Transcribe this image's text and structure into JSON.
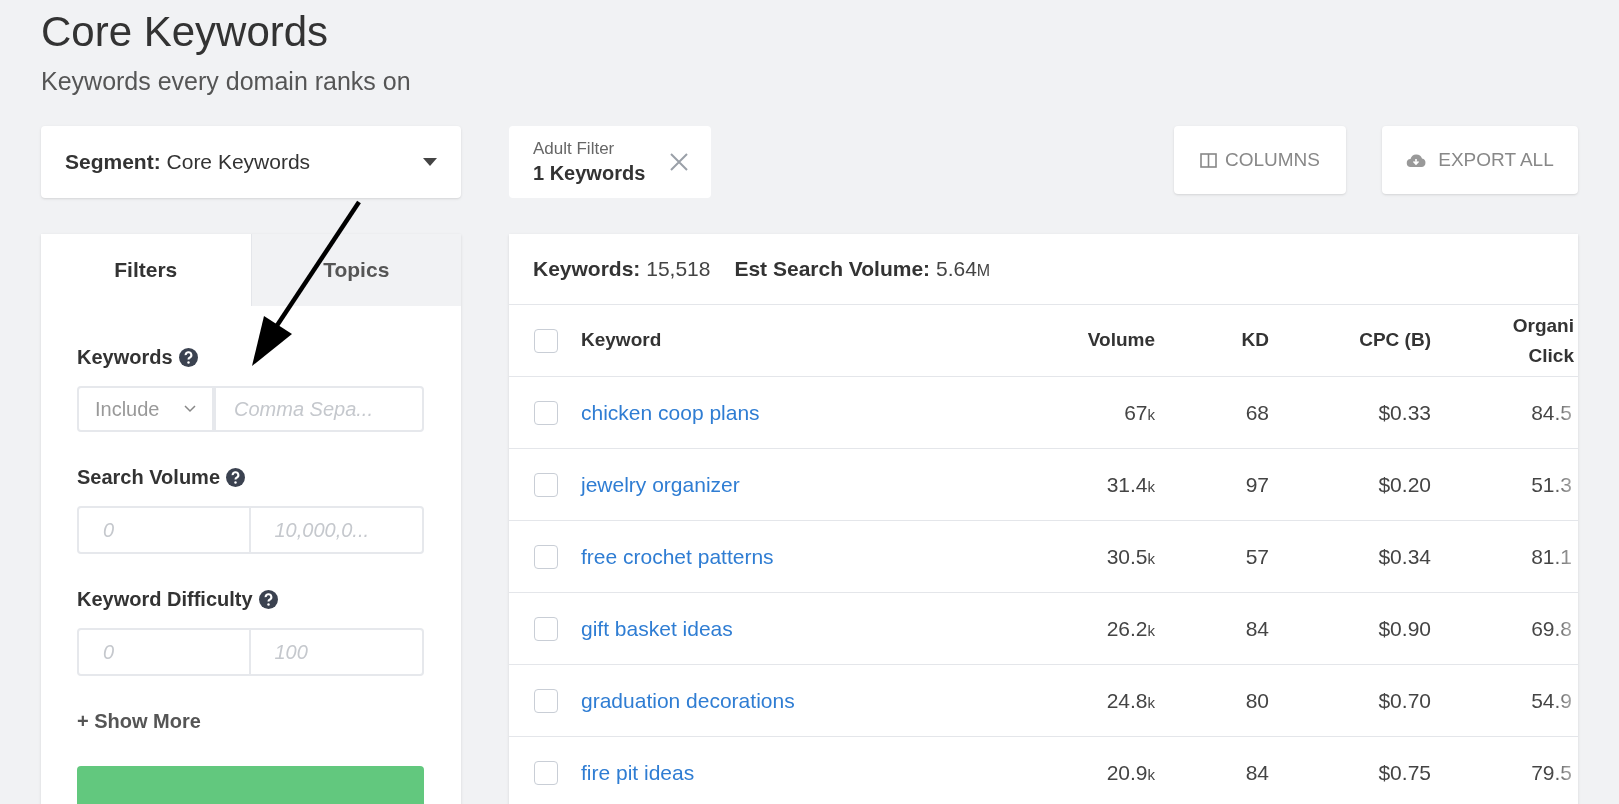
{
  "page": {
    "title": "Core Keywords",
    "subtitle": "Keywords every domain ranks on"
  },
  "segment": {
    "label": "Segment:",
    "value": "Core Keywords"
  },
  "active_filter": {
    "label": "Adult Filter",
    "value": "1 Keywords"
  },
  "toolbar": [
    "COLUMNS",
    "EXPORT ALL"
  ],
  "side_tabs": [
    {
      "label": "Filters",
      "selected": true
    },
    {
      "label": "Topics",
      "selected": false
    }
  ],
  "filters": [
    {
      "kind": "text",
      "label": "Keywords",
      "mode": "Include",
      "placeholder": "Comma Sepa..."
    },
    {
      "kind": "range",
      "label": "Search Volume",
      "min_placeholder": "0",
      "max_placeholder": "10,000,0..."
    },
    {
      "kind": "range",
      "label": "Keyword Difficulty",
      "min_placeholder": "0",
      "max_placeholder": "100"
    }
  ],
  "show_more": "+ Show More",
  "summary": [
    {
      "label": "Keywords:",
      "value": "15,518"
    },
    {
      "label": "Est Search Volume:",
      "value": "5.64",
      "unit": "M"
    }
  ],
  "table": {
    "all_checked": false,
    "columns": [
      {
        "label": "Keyword"
      },
      {
        "label": "Volume"
      },
      {
        "label": "KD"
      },
      {
        "label": "CPC (B)"
      },
      {
        "label": "Organi",
        "label_2": "Click"
      }
    ],
    "rows": [
      {
        "checked": false,
        "keyword": "chicken coop plans",
        "volume": "67",
        "unit": "k",
        "kd": "68",
        "cpc": "$0.33",
        "organic": "84.5"
      },
      {
        "checked": false,
        "keyword": "jewelry organizer",
        "volume": "31.4",
        "unit": "k",
        "kd": "97",
        "cpc": "$0.20",
        "organic": "51.3"
      },
      {
        "checked": false,
        "keyword": "free crochet patterns",
        "volume": "30.5",
        "unit": "k",
        "kd": "57",
        "cpc": "$0.34",
        "organic": "81.1"
      },
      {
        "checked": false,
        "keyword": "gift basket ideas",
        "volume": "26.2",
        "unit": "k",
        "kd": "84",
        "cpc": "$0.90",
        "organic": "69.8"
      },
      {
        "checked": false,
        "keyword": "graduation decorations",
        "volume": "24.8",
        "unit": "k",
        "kd": "80",
        "cpc": "$0.70",
        "organic": "54.9"
      },
      {
        "checked": false,
        "keyword": "fire pit ideas",
        "volume": "20.9",
        "unit": "k",
        "kd": "84",
        "cpc": "$0.75",
        "organic": "79.5"
      }
    ]
  }
}
